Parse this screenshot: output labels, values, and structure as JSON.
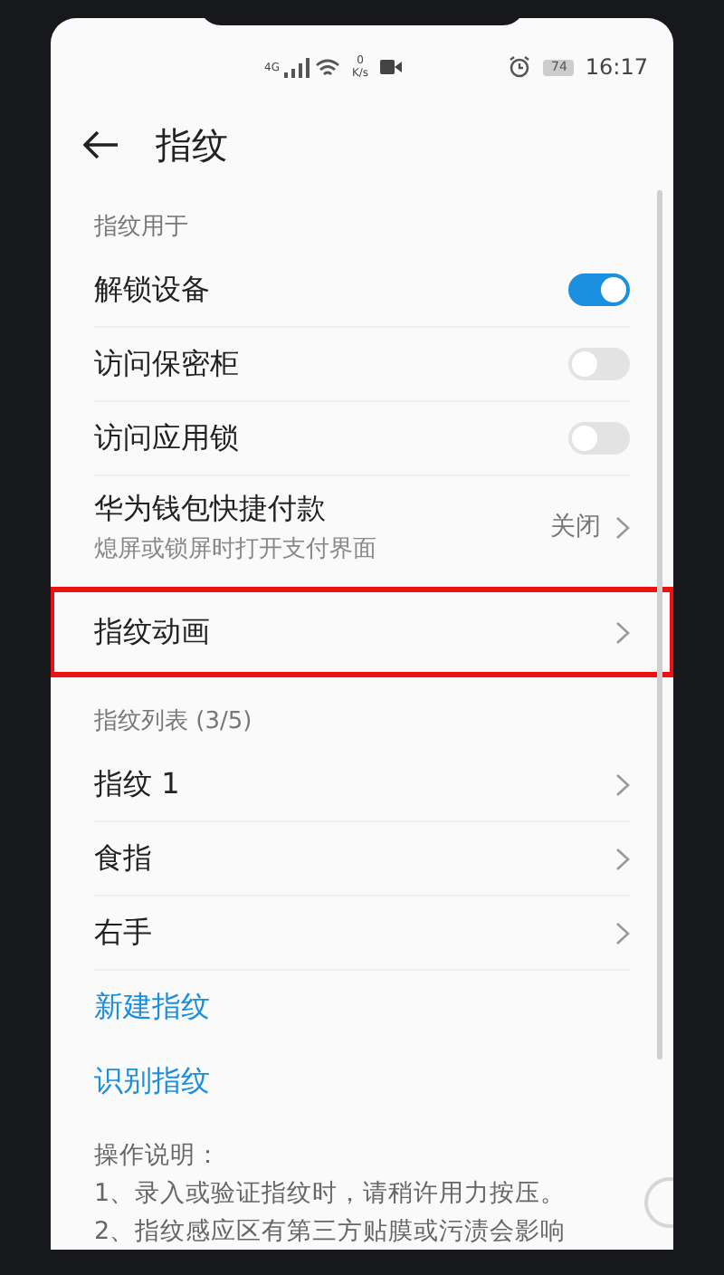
{
  "status_bar": {
    "network": "4G",
    "speed_value": "0",
    "speed_unit": "K/s",
    "battery": "74",
    "time": "16:17"
  },
  "header": {
    "title": "指纹"
  },
  "sections": [
    {
      "title": "指纹用于",
      "items": [
        {
          "kind": "toggle",
          "label": "解锁设备",
          "on": true
        },
        {
          "kind": "toggle",
          "label": "访问保密柜",
          "on": false
        },
        {
          "kind": "toggle",
          "label": "访问应用锁",
          "on": false
        },
        {
          "kind": "link",
          "label": "华为钱包快捷付款",
          "subtitle": "熄屏或锁屏时打开支付界面",
          "value": "关闭"
        }
      ]
    },
    {
      "items": [
        {
          "kind": "link",
          "label": "指纹动画",
          "highlighted": true
        }
      ]
    },
    {
      "title": "指纹列表 (3/5)",
      "items": [
        {
          "kind": "link",
          "label": "指纹 1"
        },
        {
          "kind": "link",
          "label": "食指"
        },
        {
          "kind": "link",
          "label": "右手"
        },
        {
          "kind": "action",
          "label": "新建指纹"
        },
        {
          "kind": "action",
          "label": "识别指纹"
        }
      ]
    }
  ],
  "instructions": {
    "title": "操作说明：",
    "lines": [
      "1、录入或验证指纹时，请稍许用力按压。",
      "2、指纹感应区有第三方贴膜或污渍会影响"
    ]
  }
}
